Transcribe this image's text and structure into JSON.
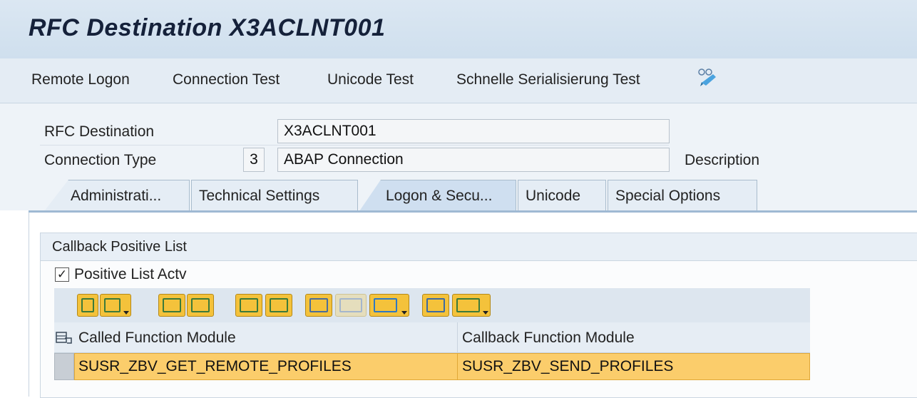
{
  "window": {
    "title": "RFC Destination X3ACLNT001"
  },
  "toolbar": {
    "items": [
      "Remote Logon",
      "Connection Test",
      "Unicode Test",
      "Schnelle Serialisierung Test"
    ],
    "icon": "glasses-display-icon"
  },
  "header": {
    "rfc_destination_label": "RFC Destination",
    "rfc_destination_value": "X3ACLNT001",
    "connection_type_label": "Connection Type",
    "connection_type_code": "3",
    "connection_type_value": "ABAP Connection",
    "description_label": "Description"
  },
  "tabs": [
    {
      "label": "Administrati...",
      "active": false
    },
    {
      "label": "Technical Settings",
      "active": false
    },
    {
      "label": "Logon & Secu...",
      "active": true
    },
    {
      "label": "Unicode",
      "active": false
    },
    {
      "label": "Special Options",
      "active": false
    }
  ],
  "callback_group": {
    "title": "Callback Positive List",
    "checkbox_label": "Positive List Actv",
    "checkbox_checked": true,
    "checkmark": "✓"
  },
  "alv_toolbar": {
    "icons": [
      "copy-icon",
      "paste-menu-icon",
      "insert-row-icon",
      "delete-row-icon",
      "sort-ascending-icon",
      "sort-descending-icon",
      "find-icon",
      "find-next-icon",
      "filter-menu-icon",
      "print-icon",
      "export-icon"
    ]
  },
  "table": {
    "columns": [
      "Called Function Module",
      "Callback Function Module"
    ],
    "rows": [
      {
        "called": "SUSR_ZBV_GET_REMOTE_PROFILES",
        "callback": "SUSR_ZBV_SEND_PROFILES"
      }
    ]
  },
  "colors": {
    "selected_row": "#fbcd6b",
    "alv_icon": "#f4c23b",
    "active_tab": "#cfdff0"
  }
}
